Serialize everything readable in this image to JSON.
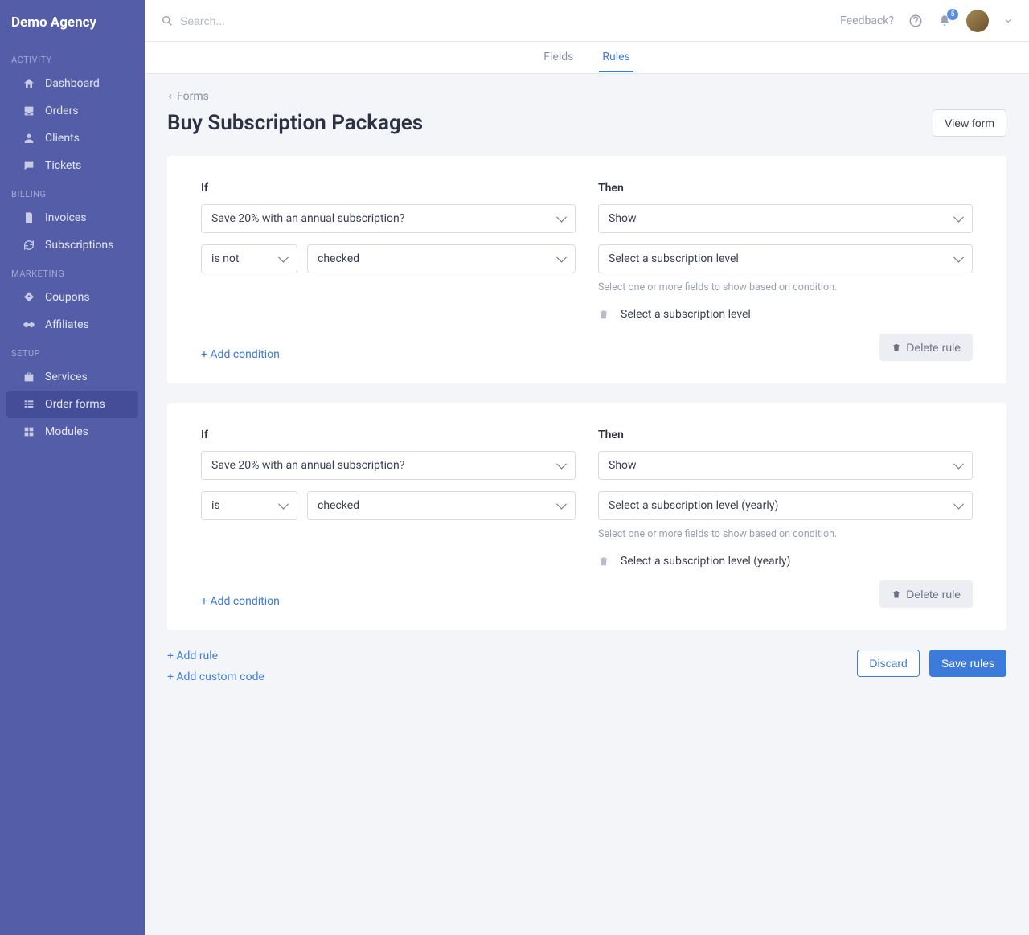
{
  "brand": "Demo Agency",
  "nav": {
    "sections": [
      {
        "title": "ACTIVITY",
        "items": [
          {
            "id": "dashboard",
            "label": "Dashboard",
            "icon": "home"
          },
          {
            "id": "orders",
            "label": "Orders",
            "icon": "inbox"
          },
          {
            "id": "clients",
            "label": "Clients",
            "icon": "user"
          },
          {
            "id": "tickets",
            "label": "Tickets",
            "icon": "chat"
          }
        ]
      },
      {
        "title": "BILLING",
        "items": [
          {
            "id": "invoices",
            "label": "Invoices",
            "icon": "file"
          },
          {
            "id": "subscriptions",
            "label": "Subscriptions",
            "icon": "refresh"
          }
        ]
      },
      {
        "title": "MARKETING",
        "items": [
          {
            "id": "coupons",
            "label": "Coupons",
            "icon": "tag"
          },
          {
            "id": "affiliates",
            "label": "Affiliates",
            "icon": "handshake"
          }
        ]
      },
      {
        "title": "SETUP",
        "items": [
          {
            "id": "services",
            "label": "Services",
            "icon": "briefcase"
          },
          {
            "id": "order-forms",
            "label": "Order forms",
            "icon": "list",
            "active": true
          },
          {
            "id": "modules",
            "label": "Modules",
            "icon": "grid"
          }
        ]
      }
    ]
  },
  "topbar": {
    "search_placeholder": "Search...",
    "feedback": "Feedback?",
    "notification_count": "5"
  },
  "subtabs": {
    "fields": "Fields",
    "rules": "Rules"
  },
  "breadcrumb": "Forms",
  "page_title": "Buy Subscription Packages",
  "view_form_btn": "View form",
  "rules": [
    {
      "if_label": "If",
      "then_label": "Then",
      "field": "Save 20% with an annual subscription?",
      "operator": "is not",
      "value": "checked",
      "action": "Show",
      "target": "Select a subscription level",
      "hint": "Select one or more fields to show based on condition.",
      "chip": "Select a subscription level",
      "add_condition": "+ Add condition",
      "delete_label": "Delete rule"
    },
    {
      "if_label": "If",
      "then_label": "Then",
      "field": "Save 20% with an annual subscription?",
      "operator": "is",
      "value": "checked",
      "action": "Show",
      "target": "Select a subscription level (yearly)",
      "hint": "Select one or more fields to show based on condition.",
      "chip": "Select a subscription level (yearly)",
      "add_condition": "+ Add condition",
      "delete_label": "Delete rule"
    }
  ],
  "footer": {
    "add_rule": "+ Add rule",
    "add_custom_code": "+ Add custom code",
    "discard": "Discard",
    "save": "Save rules"
  }
}
